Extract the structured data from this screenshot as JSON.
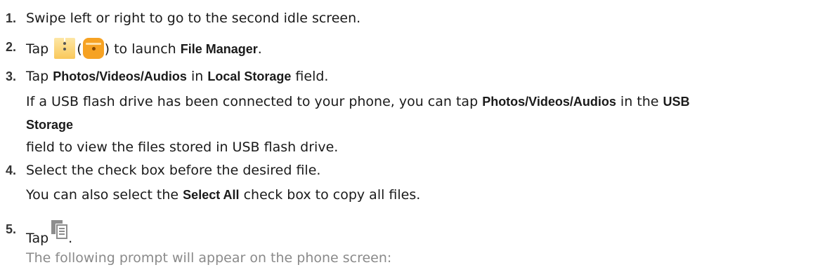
{
  "steps": [
    {
      "num": "1.",
      "text": "Swipe left or right to go to the second idle screen."
    },
    {
      "num": "2.",
      "pre": "Tap",
      "paren_open": "(",
      "paren_close": ")",
      "mid": "to launch",
      "bold": "File Manager",
      "end": ".",
      "icons": [
        "file-manager-zip-icon",
        "file-manager-folder-icon"
      ]
    },
    {
      "num": "3.",
      "pre": "Tap",
      "bold1": "Photos/Videos/Audios",
      "mid": "in",
      "bold2": "Local Storage",
      "end": "field.",
      "note1_pre": "If a USB flash drive has been connected to your phone, you can tap",
      "note1_bold1": "Photos/Videos/Audios",
      "note1_mid": "in the",
      "note1_bold2": "USB",
      "note2_bold": "Storage",
      "note3": "field to view the files stored in USB flash drive."
    },
    {
      "num": "4.",
      "text": "Select the check box before the desired file.",
      "note_pre": "You can also select the",
      "note_bold": "Select All",
      "note_end": "check box to copy all files."
    },
    {
      "num": "5.",
      "pre": "Tap",
      "end": ".",
      "icon": "copy-icon",
      "note": "The following prompt will appear on the phone screen:"
    }
  ],
  "colors": {
    "text": "#1a1a1a",
    "note_gray": "#8a8a8a",
    "icon_gray": "#8d8d8d",
    "folder_orange": "#f6a223"
  }
}
